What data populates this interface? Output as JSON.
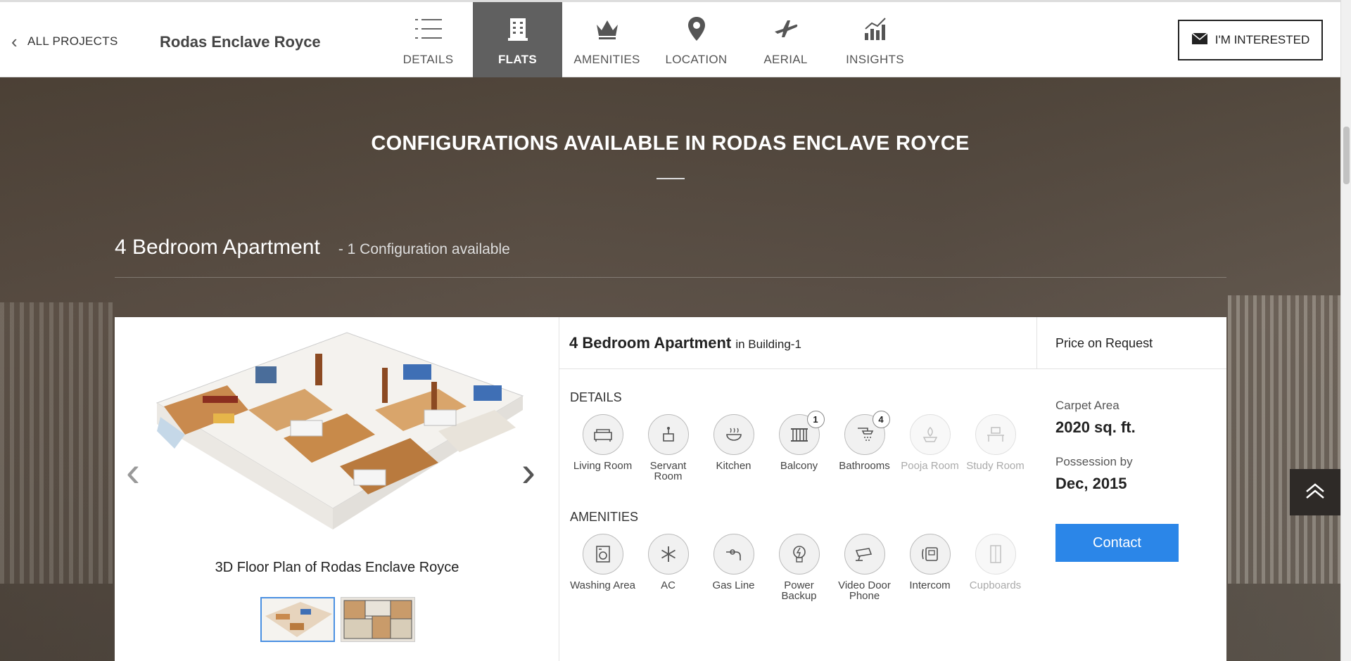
{
  "header": {
    "back_label": "ALL PROJECTS",
    "project_title": "Rodas Enclave Royce",
    "nav": [
      {
        "label": "DETAILS",
        "icon": "list-icon",
        "active": false
      },
      {
        "label": "FLATS",
        "icon": "building-icon",
        "active": true
      },
      {
        "label": "AMENITIES",
        "icon": "crown-icon",
        "active": false
      },
      {
        "label": "LOCATION",
        "icon": "map-pin-icon",
        "active": false
      },
      {
        "label": "AERIAL",
        "icon": "airplane-icon",
        "active": false
      },
      {
        "label": "INSIGHTS",
        "icon": "bar-chart-icon",
        "active": false
      }
    ],
    "interested_label": "I'M INTERESTED"
  },
  "section": {
    "title": "CONFIGURATIONS AVAILABLE IN RODAS ENCLAVE ROYCE",
    "config_type": "4 Bedroom Apartment",
    "config_count": "- 1 Configuration available"
  },
  "card": {
    "gallery_caption": "3D Floor Plan of Rodas Enclave Royce",
    "apartment_title": "4 Bedroom Apartment",
    "apartment_location": "in Building-1",
    "price": "Price on Request",
    "details_label": "DETAILS",
    "details": [
      {
        "name": "Living Room",
        "icon": "sofa-icon",
        "available": true,
        "count": ""
      },
      {
        "name": "Servant Room",
        "icon": "servant-icon",
        "available": true,
        "count": ""
      },
      {
        "name": "Kitchen",
        "icon": "cooking-pot-icon",
        "available": true,
        "count": ""
      },
      {
        "name": "Balcony",
        "icon": "railing-icon",
        "available": true,
        "count": "1"
      },
      {
        "name": "Bathrooms",
        "icon": "shower-icon",
        "available": true,
        "count": "4"
      },
      {
        "name": "Pooja Room",
        "icon": "lamp-icon",
        "available": false,
        "count": ""
      },
      {
        "name": "Study Room",
        "icon": "desk-icon",
        "available": false,
        "count": ""
      }
    ],
    "amenities_label": "AMENITIES",
    "amenities": [
      {
        "name": "Washing Area",
        "icon": "washing-machine-icon",
        "available": true
      },
      {
        "name": "AC",
        "icon": "snowflake-icon",
        "available": true
      },
      {
        "name": "Gas Line",
        "icon": "gas-pipe-icon",
        "available": true
      },
      {
        "name": "Power Backup",
        "icon": "bulb-icon",
        "available": true
      },
      {
        "name": "Video Door Phone",
        "icon": "camera-icon",
        "available": true
      },
      {
        "name": "Intercom",
        "icon": "phone-icon",
        "available": true
      },
      {
        "name": "Cupboards",
        "icon": "cupboard-icon",
        "available": false
      }
    ],
    "carpet_area_label": "Carpet Area",
    "carpet_area_value": "2020 sq. ft.",
    "possession_label": "Possession by",
    "possession_value": "Dec, 2015",
    "contact_label": "Contact"
  }
}
